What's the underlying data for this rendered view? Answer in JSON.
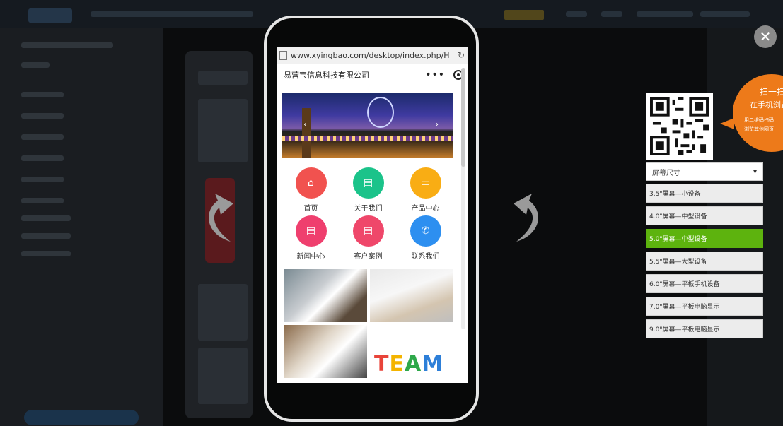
{
  "preview": {
    "url": "www.xyingbao.com/desktop/index.php/H",
    "page_title": "易营宝信息科技有限公司",
    "menu_dots": "•••",
    "nav_items": [
      {
        "label": "首页",
        "color": "#f1524f",
        "icon": "home-icon"
      },
      {
        "label": "关于我们",
        "color": "#1bc38a",
        "icon": "document-icon"
      },
      {
        "label": "产品中心",
        "color": "#f9ad14",
        "icon": "box-icon"
      },
      {
        "label": "新闻中心",
        "color": "#ef3f6e",
        "icon": "document-icon"
      },
      {
        "label": "客户案例",
        "color": "#ef476a",
        "icon": "document-icon"
      },
      {
        "label": "联系我们",
        "color": "#2d8ff0",
        "icon": "phone-icon"
      }
    ],
    "team_text": "TEAM"
  },
  "qr_bubble": {
    "line1": "扫一扫",
    "line2": "在手机浏览",
    "line3": "用二维码扫码",
    "line4": "浏览其他网页"
  },
  "screen_size": {
    "label": "屏幕尺寸",
    "options": [
      "3.5\"屏幕—小设备",
      "4.0\"屏幕—中型设备",
      "5.0\"屏幕—中型设备",
      "5.5\"屏幕—大型设备",
      "6.0\"屏幕—平板手机设备",
      "7.0\"屏幕—平板电脑显示",
      "9.0\"屏幕—平板电脑显示"
    ],
    "selected_index": 2
  },
  "colors": {
    "accent_green": "#5db30e",
    "bubble_orange": "#ed7a1a"
  }
}
